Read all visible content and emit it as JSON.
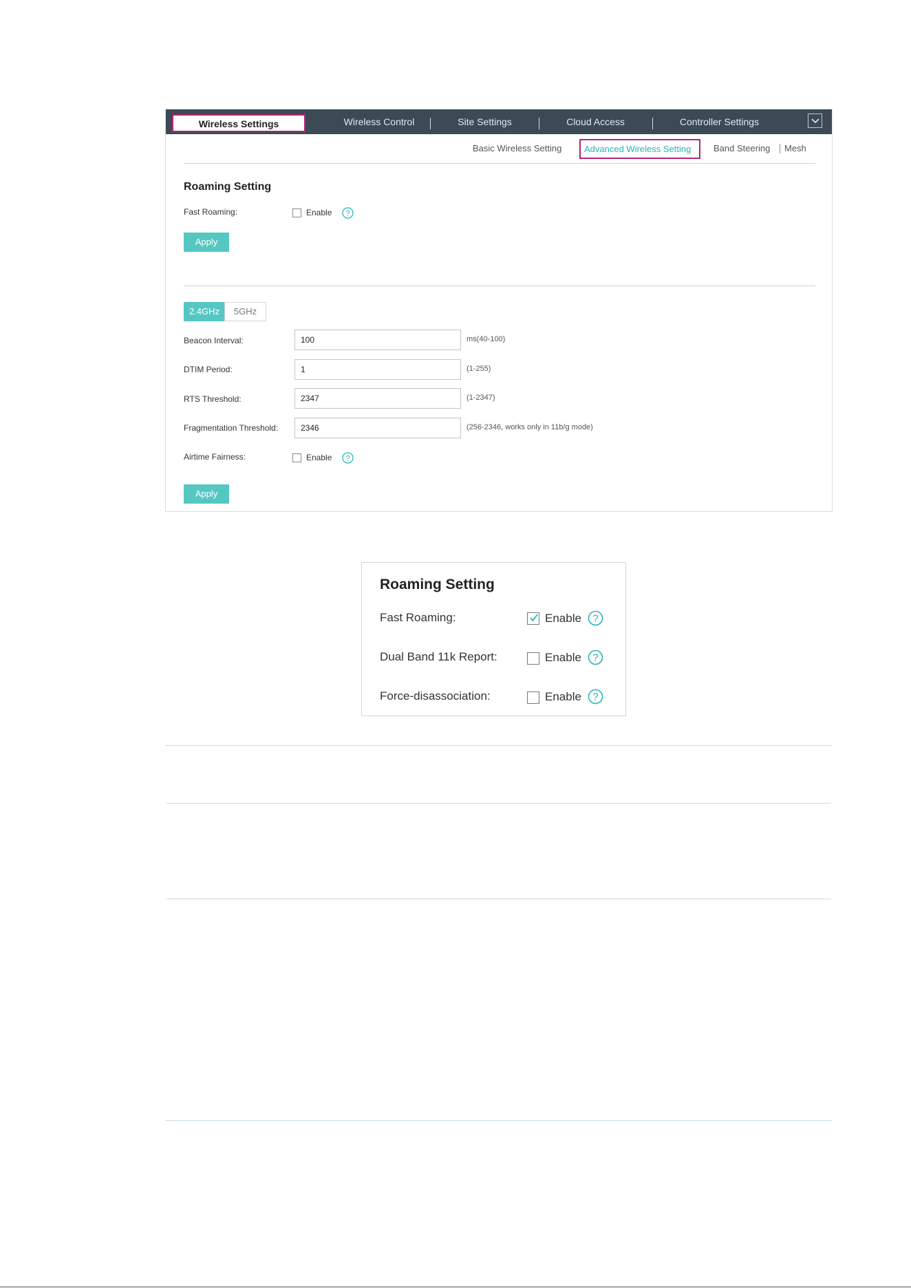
{
  "top_nav": {
    "items": [
      {
        "label": "Wireless Settings",
        "active": true
      },
      {
        "label": "Wireless Control",
        "active": false
      },
      {
        "label": "Site Settings",
        "active": false
      },
      {
        "label": "Cloud Access",
        "active": false
      },
      {
        "label": "Controller Settings",
        "active": false
      }
    ],
    "dropdown_icon": "chevron-down-icon"
  },
  "sub_tabs": {
    "items": [
      {
        "label": "Basic Wireless Setting",
        "active": false
      },
      {
        "label": "Advanced Wireless Setting",
        "active": true
      },
      {
        "label": "Band Steering",
        "active": false
      },
      {
        "label": "Mesh",
        "active": false
      }
    ]
  },
  "roaming": {
    "title": "Roaming Setting",
    "fast_roaming_label": "Fast Roaming:",
    "fast_roaming_enable": "Enable",
    "fast_roaming_checked": false,
    "apply_label": "Apply"
  },
  "band": {
    "tabs": [
      {
        "label": "2.4GHz",
        "active": true
      },
      {
        "label": "5GHz",
        "active": false
      }
    ],
    "fields": [
      {
        "label": "Beacon Interval:",
        "value": "100",
        "hint": "ms(40-100)"
      },
      {
        "label": "DTIM Period:",
        "value": "1",
        "hint": "(1-255)"
      },
      {
        "label": "RTS Threshold:",
        "value": "2347",
        "hint": "(1-2347)"
      },
      {
        "label": "Fragmentation Threshold:",
        "value": "2346",
        "hint": "(256-2346, works only in 11b/g mode)"
      }
    ],
    "airtime_label": "Airtime Fairness:",
    "airtime_enable": "Enable",
    "airtime_checked": false,
    "apply_label": "Apply"
  },
  "zoom": {
    "title": "Roaming Setting",
    "rows": [
      {
        "label": "Fast Roaming:",
        "enable": "Enable",
        "checked": true
      },
      {
        "label": "Dual Band 11k Report:",
        "enable": "Enable",
        "checked": false
      },
      {
        "label": "Force-disassociation:",
        "enable": "Enable",
        "checked": false
      }
    ]
  },
  "colors": {
    "accent": "#55c7c3",
    "highlight_border": "#b4237a",
    "nav_background": "#3c4a55"
  }
}
